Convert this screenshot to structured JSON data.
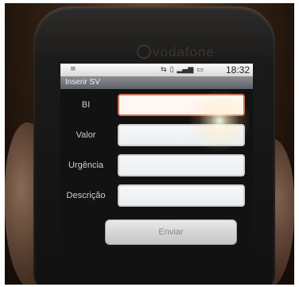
{
  "device": {
    "brand": "vodafone"
  },
  "statusbar": {
    "time": "18:32",
    "icons": [
      "usb-icon",
      "signal-icon",
      "battery-icon"
    ]
  },
  "header": {
    "title": "Inserir SV"
  },
  "form": {
    "fields": [
      {
        "label": "BI",
        "value": ""
      },
      {
        "label": "Valor",
        "value": ""
      },
      {
        "label": "Urgência",
        "value": ""
      },
      {
        "label": "Descrição",
        "value": ""
      }
    ],
    "submit_label": "Enviar"
  },
  "colors": {
    "focus_border": "#d86f4a",
    "title_bar": "#6f7377"
  }
}
